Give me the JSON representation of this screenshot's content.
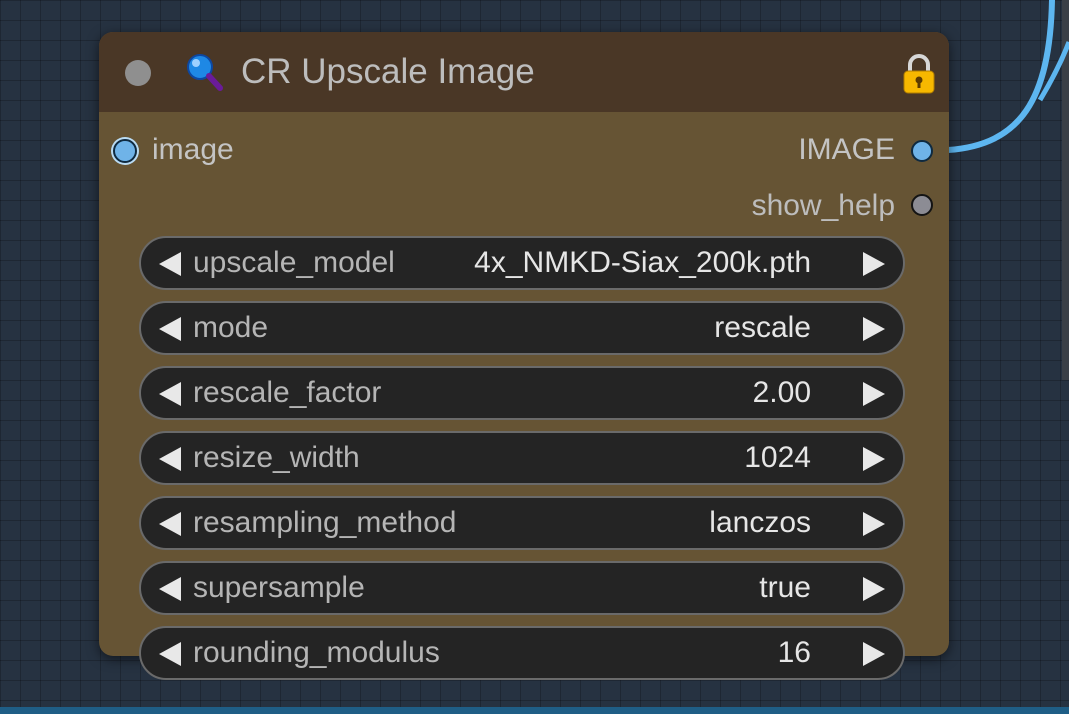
{
  "node": {
    "title": "CR Upscale Image",
    "header_color": "#4a3726",
    "body_color": "#665434",
    "icons": {
      "title": "magnifier-icon",
      "lock": "lock-icon",
      "collapse": "collapse-dot-icon"
    },
    "inputs": [
      {
        "label": "image",
        "type_color": "#6fb3e8"
      }
    ],
    "outputs": [
      {
        "label": "IMAGE",
        "type_color": "#6fb3e8",
        "connected": true
      },
      {
        "label": "show_help",
        "type_color": "#8c8c94",
        "connected": false
      }
    ],
    "widgets": [
      {
        "name": "upscale_model",
        "value": "4x_NMKD-Siax_200k.pth"
      },
      {
        "name": "mode",
        "value": "rescale"
      },
      {
        "name": "rescale_factor",
        "value": "2.00"
      },
      {
        "name": "resize_width",
        "value": "1024"
      },
      {
        "name": "resampling_method",
        "value": "lanczos"
      },
      {
        "name": "supersample",
        "value": "true"
      },
      {
        "name": "rounding_modulus",
        "value": "16"
      }
    ]
  },
  "canvas": {
    "background": "#263241",
    "link_color": "#5db6f0"
  }
}
